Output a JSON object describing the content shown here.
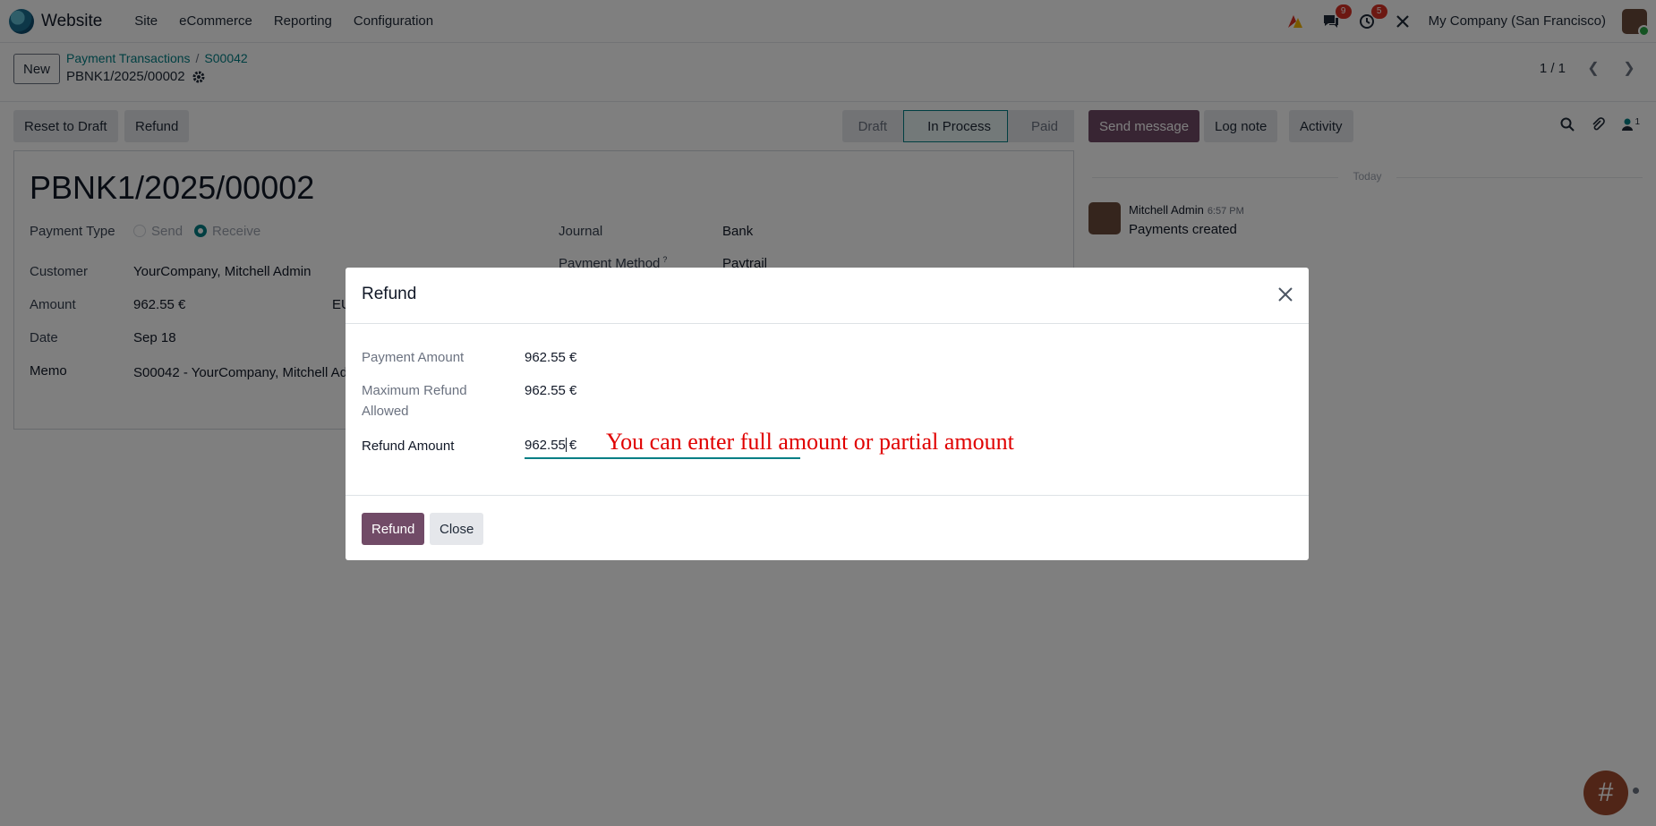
{
  "navbar": {
    "app_name": "Website",
    "menu": [
      "Site",
      "eCommerce",
      "Reporting",
      "Configuration"
    ],
    "messages_badge": "9",
    "activities_badge": "5",
    "company": "My Company (San Francisco)"
  },
  "control_panel": {
    "new_label": "New",
    "breadcrumb": [
      "Payment Transactions",
      "S00042"
    ],
    "record_name": "PBNK1/2025/00002",
    "pager": "1 / 1"
  },
  "actions": {
    "reset_to_draft": "Reset to Draft",
    "refund": "Refund"
  },
  "stages": [
    "Draft",
    "In Process",
    "Paid"
  ],
  "active_stage": "In Process",
  "form": {
    "title": "PBNK1/2025/00002",
    "payment_type_label": "Payment Type",
    "payment_type_options": [
      "Send",
      "Receive"
    ],
    "payment_type_selected": "Receive",
    "customer_label": "Customer",
    "customer_value": "YourCompany, Mitchell Admin",
    "amount_label": "Amount",
    "amount_value": "962.55 €",
    "currency_fragment": "EU",
    "date_label": "Date",
    "date_value": "Sep 18",
    "memo_label": "Memo",
    "memo_value": "S00042 - YourCompany, Mitchell Ad",
    "journal_label": "Journal",
    "journal_value": "Bank",
    "payment_method_label": "Payment Method",
    "payment_method_value": "Paytrail"
  },
  "chatter": {
    "send_message": "Send message",
    "log_note": "Log note",
    "activity": "Activity",
    "followers_count": "1",
    "date_separator": "Today",
    "message": {
      "author": "Mitchell Admin",
      "time": "6:57 PM",
      "body": "Payments created"
    }
  },
  "modal": {
    "title": "Refund",
    "payment_amount_label": "Payment Amount",
    "payment_amount_value": "962.55 €",
    "max_refund_label_line1": "Maximum Refund",
    "max_refund_label_line2": "Allowed",
    "max_refund_value": "962.55 €",
    "refund_amount_label": "Refund Amount",
    "refund_amount_value": "962.55",
    "refund_amount_currency": "€",
    "annotation": "You can enter full amount or partial amount",
    "refund_button": "Refund",
    "close_button": "Close"
  },
  "colors": {
    "brand": "#714b67",
    "link": "#017e84",
    "annotation": "#e00000"
  }
}
